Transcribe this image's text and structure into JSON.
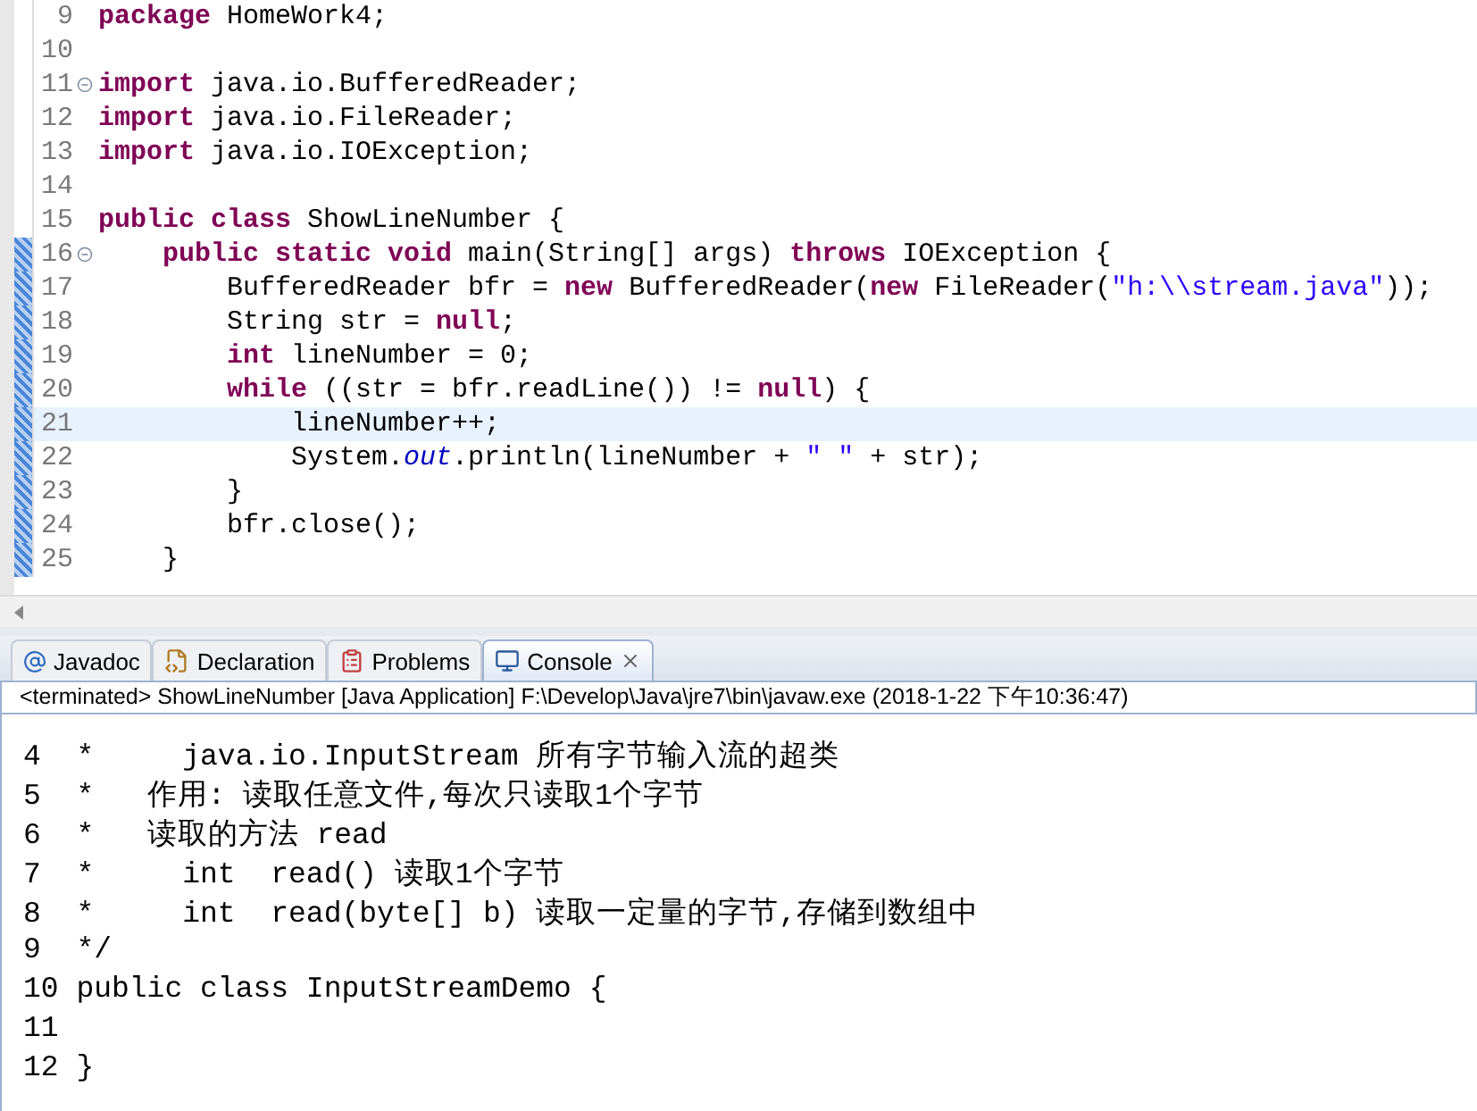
{
  "editor": {
    "lines": [
      {
        "number": "9",
        "foldable": false,
        "in_range": false,
        "current": false,
        "tokens": [
          {
            "kind": "keyword",
            "text": "package"
          },
          {
            "kind": "plain",
            "text": " HomeWork4;"
          }
        ]
      },
      {
        "number": "10",
        "foldable": false,
        "in_range": false,
        "current": false
      },
      {
        "number": "11",
        "foldable": true,
        "in_range": false,
        "current": false,
        "tokens": [
          {
            "kind": "keyword",
            "text": "import"
          },
          {
            "kind": "plain",
            "text": " java.io.BufferedReader;"
          }
        ]
      },
      {
        "number": "12",
        "foldable": false,
        "in_range": false,
        "current": false,
        "tokens": [
          {
            "kind": "keyword",
            "text": "import"
          },
          {
            "kind": "plain",
            "text": " java.io.FileReader;"
          }
        ]
      },
      {
        "number": "13",
        "foldable": false,
        "in_range": false,
        "current": false,
        "tokens": [
          {
            "kind": "keyword",
            "text": "import"
          },
          {
            "kind": "plain",
            "text": " java.io.IOException;"
          }
        ]
      },
      {
        "number": "14",
        "foldable": false,
        "in_range": false,
        "current": false
      },
      {
        "number": "15",
        "foldable": false,
        "in_range": false,
        "current": false,
        "tokens": [
          {
            "kind": "keyword",
            "text": "public class"
          },
          {
            "kind": "plain",
            "text": " ShowLineNumber {"
          }
        ]
      },
      {
        "number": "16",
        "foldable": true,
        "in_range": true,
        "current": false,
        "tokens": [
          {
            "kind": "keyword",
            "text": "    public static void"
          },
          {
            "kind": "plain",
            "text": " main(String[] args) "
          },
          {
            "kind": "keyword",
            "text": "throws"
          },
          {
            "kind": "plain",
            "text": " IOException {"
          }
        ]
      },
      {
        "number": "17",
        "foldable": false,
        "in_range": true,
        "current": false,
        "tokens": [
          {
            "kind": "plain",
            "text": "        BufferedReader bfr = "
          },
          {
            "kind": "keyword",
            "text": "new"
          },
          {
            "kind": "plain",
            "text": " BufferedReader("
          },
          {
            "kind": "keyword",
            "text": "new"
          },
          {
            "kind": "plain",
            "text": " FileReader("
          },
          {
            "kind": "string",
            "text": "\"h:\\\\stream.java\""
          },
          {
            "kind": "plain",
            "text": "));"
          }
        ]
      },
      {
        "number": "18",
        "foldable": false,
        "in_range": true,
        "current": false,
        "tokens": [
          {
            "kind": "plain",
            "text": "        String str = "
          },
          {
            "kind": "keyword",
            "text": "null"
          },
          {
            "kind": "plain",
            "text": ";"
          }
        ]
      },
      {
        "number": "19",
        "foldable": false,
        "in_range": true,
        "current": false,
        "tokens": [
          {
            "kind": "keyword",
            "text": "        int"
          },
          {
            "kind": "plain",
            "text": " lineNumber = 0;"
          }
        ]
      },
      {
        "number": "20",
        "foldable": false,
        "in_range": true,
        "current": false,
        "tokens": [
          {
            "kind": "keyword",
            "text": "        while"
          },
          {
            "kind": "plain",
            "text": " ((str = bfr.readLine()) != "
          },
          {
            "kind": "keyword",
            "text": "null"
          },
          {
            "kind": "plain",
            "text": ") {"
          }
        ]
      },
      {
        "number": "21",
        "foldable": false,
        "in_range": true,
        "current": true,
        "tokens": [
          {
            "kind": "plain",
            "text": "            lineNumber++;"
          }
        ]
      },
      {
        "number": "22",
        "foldable": false,
        "in_range": true,
        "current": false,
        "tokens": [
          {
            "kind": "plain",
            "text": "            System."
          },
          {
            "kind": "field",
            "text": "out"
          },
          {
            "kind": "plain",
            "text": ".println(lineNumber + "
          },
          {
            "kind": "string",
            "text": "\" \""
          },
          {
            "kind": "plain",
            "text": " + str);"
          }
        ]
      },
      {
        "number": "23",
        "foldable": false,
        "in_range": true,
        "current": false,
        "tokens": [
          {
            "kind": "plain",
            "text": "        }"
          }
        ]
      },
      {
        "number": "24",
        "foldable": false,
        "in_range": true,
        "current": false,
        "tokens": [
          {
            "kind": "plain",
            "text": "        bfr.close();"
          }
        ]
      },
      {
        "number": "25",
        "foldable": false,
        "in_range": true,
        "current": false,
        "tokens": [
          {
            "kind": "plain",
            "text": "    }"
          }
        ]
      }
    ]
  },
  "tabs": [
    {
      "label": "Javadoc",
      "selected": false,
      "closable": false
    },
    {
      "label": "Declaration",
      "selected": false,
      "closable": false
    },
    {
      "label": "Problems",
      "selected": false,
      "closable": false
    },
    {
      "label": "Console",
      "selected": true,
      "closable": true
    }
  ],
  "console": {
    "status": "<terminated> ShowLineNumber [Java Application] F:\\Develop\\Java\\jre7\\bin\\javaw.exe (2018-1-22 下午10:36:47)",
    "lines": [
      "4  *     java.io.InputStream 所有字节输入流的超类",
      "5  *   作用: 读取任意文件,每次只读取1个字节",
      "6  *   读取的方法 read",
      "7  *     int  read() 读取1个字节",
      "8  *     int  read(byte[] b) 读取一定量的字节,存储到数组中",
      "9  */",
      "10 public class InputStreamDemo {",
      "11",
      "12 }"
    ]
  }
}
